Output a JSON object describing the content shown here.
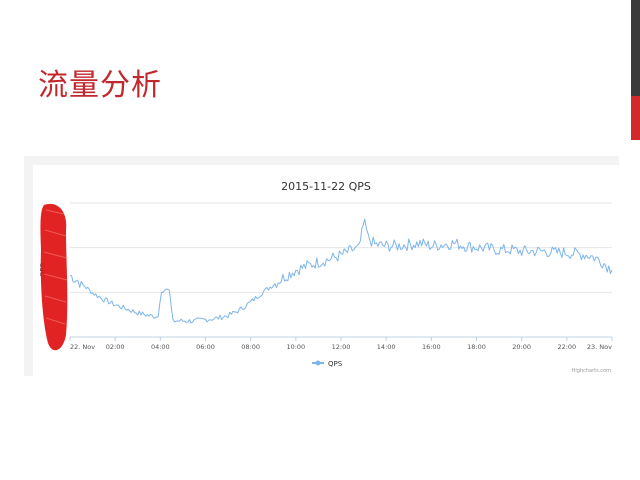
{
  "slide": {
    "title": "流量分析",
    "accent_color": "#c0282e"
  },
  "chart_data": {
    "type": "line",
    "title": "2015-11-22 QPS",
    "xlabel": "",
    "ylabel": "QPS",
    "x_ticks": [
      "22. Nov",
      "02:00",
      "04:00",
      "06:00",
      "08:00",
      "10:00",
      "12:00",
      "14:00",
      "16:00",
      "18:00",
      "20:00",
      "22:00",
      "23. Nov"
    ],
    "xlim": [
      0,
      24
    ],
    "ylim": [
      0,
      100
    ],
    "grid": true,
    "legend": "bottom-center",
    "credits": "Highcharts.com",
    "series_color": "#7cb5ec",
    "series": [
      {
        "name": "QPS",
        "x": [
          0,
          0.5,
          1,
          1.5,
          2,
          2.5,
          3,
          3.5,
          3.9,
          4.05,
          4.4,
          4.55,
          5,
          5.5,
          6,
          6.5,
          7,
          7.5,
          8,
          8.5,
          9,
          9.5,
          10,
          10.5,
          11,
          11.5,
          12,
          12.5,
          12.8,
          13.05,
          13.2,
          13.5,
          14,
          14.5,
          15,
          15.5,
          16,
          16.5,
          17,
          17.5,
          18,
          18.5,
          19,
          19.5,
          20,
          20.5,
          21,
          21.5,
          22,
          22.5,
          23,
          23.5,
          24
        ],
        "values": [
          46,
          40,
          33,
          28,
          24,
          21,
          18,
          16,
          15,
          35,
          35,
          12,
          12,
          12,
          13,
          14,
          16,
          20,
          26,
          33,
          39,
          45,
          50,
          53,
          56,
          58,
          61,
          65,
          66,
          88,
          74,
          69,
          68,
          68,
          69,
          70,
          68,
          69,
          70,
          68,
          67,
          66,
          65,
          65,
          64,
          64,
          64,
          63,
          63,
          62,
          61,
          57,
          50
        ]
      }
    ]
  }
}
